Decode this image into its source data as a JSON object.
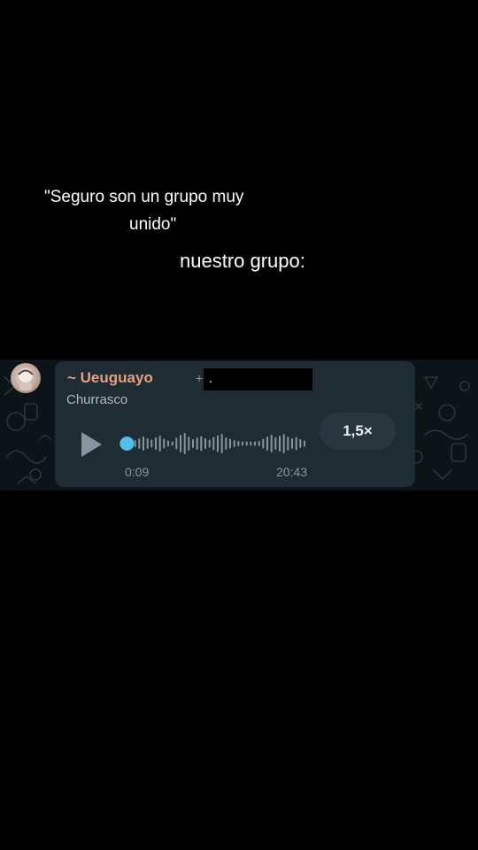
{
  "caption": {
    "line1": "\"Seguro son un grupo muy",
    "line2": "unido\"",
    "line3": "nuestro grupo:"
  },
  "message": {
    "sender": "~ Ueuguayo",
    "sender_extra": "+",
    "redacted_visible_char": ".",
    "group_name": "Churrasco"
  },
  "voice_note": {
    "current_time": "0:09",
    "total_time": "20:43",
    "speed_label": "1,5×",
    "progress_fraction": 0.007,
    "play_icon": "play-icon"
  },
  "colors": {
    "background": "#000000",
    "chat_background": "#0d1418",
    "bubble": "#1f2c33",
    "sender": "#e89f7f",
    "accent": "#53bdeb",
    "meta_text": "#8696a0"
  }
}
